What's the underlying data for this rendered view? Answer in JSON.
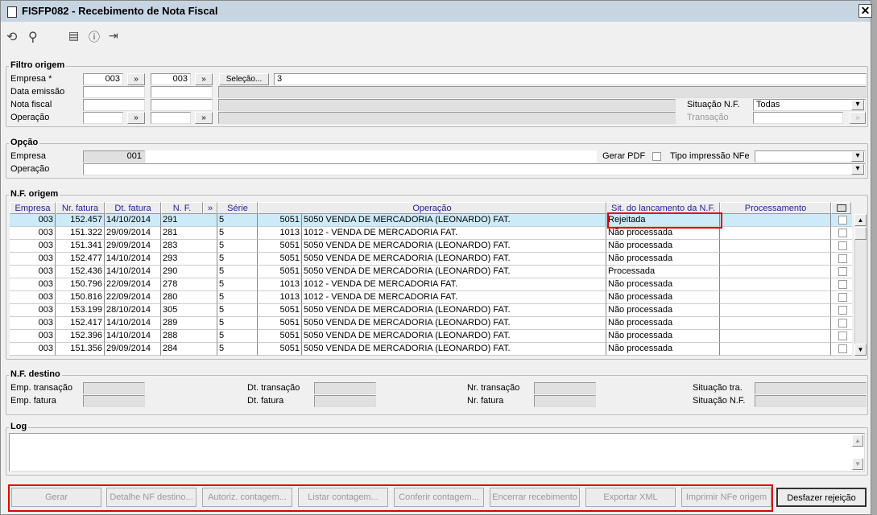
{
  "window": {
    "title": "FISFP082 - Recebimento de Nota Fiscal",
    "close": "✕"
  },
  "toolbar": {
    "icons": [
      "undo-icon",
      "search-icon",
      "calendar-icon",
      "help-icon",
      "exit-icon"
    ]
  },
  "filtro": {
    "title": "Filtro origem",
    "empresa_label": "Empresa *",
    "empresa_from": "003",
    "empresa_to": "003",
    "selecao_label": "Seleção...",
    "selecao_value": "3",
    "data_emissao_label": "Data emissão",
    "nota_fiscal_label": "Nota fiscal",
    "operacao_label": "Operação",
    "situacao_label": "Situação N.F.",
    "situacao_value": "Todas",
    "transacao_label": "Transação",
    "more": "»"
  },
  "opcao": {
    "title": "Opção",
    "empresa_label": "Empresa",
    "empresa_value": "001",
    "operacao_label": "Operação",
    "gerar_pdf_label": "Gerar PDF",
    "tipo_impressao_label": "Tipo impressão NFe"
  },
  "origem": {
    "title": "N.F. origem",
    "columns": [
      "Empresa",
      "Nr. fatura",
      "Dt. fatura",
      "N. F.",
      "»",
      "Série",
      "Operação",
      "Sit. do lancamento da N.F.",
      "Processamento"
    ],
    "rows": [
      [
        "003",
        "152.457",
        "14/10/2014",
        "291",
        "5",
        "5051",
        "5050 VENDA DE MERCADORIA (LEONARDO) FAT.",
        "Rejeitada",
        ""
      ],
      [
        "003",
        "151.322",
        "29/09/2014",
        "281",
        "5",
        "1013",
        "1012 - VENDA DE MERCADORIA FAT.",
        "Não processada",
        ""
      ],
      [
        "003",
        "151.341",
        "29/09/2014",
        "283",
        "5",
        "5051",
        "5050 VENDA DE MERCADORIA (LEONARDO) FAT.",
        "Não processada",
        ""
      ],
      [
        "003",
        "152.477",
        "14/10/2014",
        "293",
        "5",
        "5051",
        "5050 VENDA DE MERCADORIA (LEONARDO) FAT.",
        "Não processada",
        ""
      ],
      [
        "003",
        "152.436",
        "14/10/2014",
        "290",
        "5",
        "5051",
        "5050 VENDA DE MERCADORIA (LEONARDO) FAT.",
        "Processada",
        ""
      ],
      [
        "003",
        "150.796",
        "22/09/2014",
        "278",
        "5",
        "1013",
        "1012 - VENDA DE MERCADORIA FAT.",
        "Não processada",
        ""
      ],
      [
        "003",
        "150.816",
        "22/09/2014",
        "280",
        "5",
        "1013",
        "1012 - VENDA DE MERCADORIA FAT.",
        "Não processada",
        ""
      ],
      [
        "003",
        "153.199",
        "28/10/2014",
        "305",
        "5",
        "5051",
        "5050 VENDA DE MERCADORIA (LEONARDO) FAT.",
        "Não processada",
        ""
      ],
      [
        "003",
        "152.417",
        "14/10/2014",
        "289",
        "5",
        "5051",
        "5050 VENDA DE MERCADORIA (LEONARDO) FAT.",
        "Não processada",
        ""
      ],
      [
        "003",
        "152.396",
        "14/10/2014",
        "288",
        "5",
        "5051",
        "5050 VENDA DE MERCADORIA (LEONARDO) FAT.",
        "Não processada",
        ""
      ],
      [
        "003",
        "151.356",
        "29/09/2014",
        "284",
        "5",
        "5051",
        "5050 VENDA DE MERCADORIA (LEONARDO) FAT.",
        "Não processada",
        ""
      ]
    ]
  },
  "destino": {
    "title": "N.F. destino",
    "emp_transacao": "Emp. transação",
    "emp_fatura": "Emp. fatura",
    "dt_transacao": "Dt. transação",
    "dt_fatura": "Dt. fatura",
    "nr_transacao": "Nr. transação",
    "nr_fatura": "Nr. fatura",
    "situacao_tra": "Situação tra.",
    "situacao_nf": "Situação N.F."
  },
  "log": {
    "title": "Log"
  },
  "buttons": [
    "Gerar",
    "Detalhe NF destino...",
    "Autoriz. contagem...",
    "Listar contagem...",
    "Conferir contagem...",
    "Encerrar recebimento",
    "Exportar XML",
    "Imprimir NFe origem"
  ],
  "desfazer": "Desfazer rejeição",
  "colors": {
    "highlight": "#e00000",
    "selected_row": "#cceaf8",
    "header_text": "#1f1f9c"
  }
}
